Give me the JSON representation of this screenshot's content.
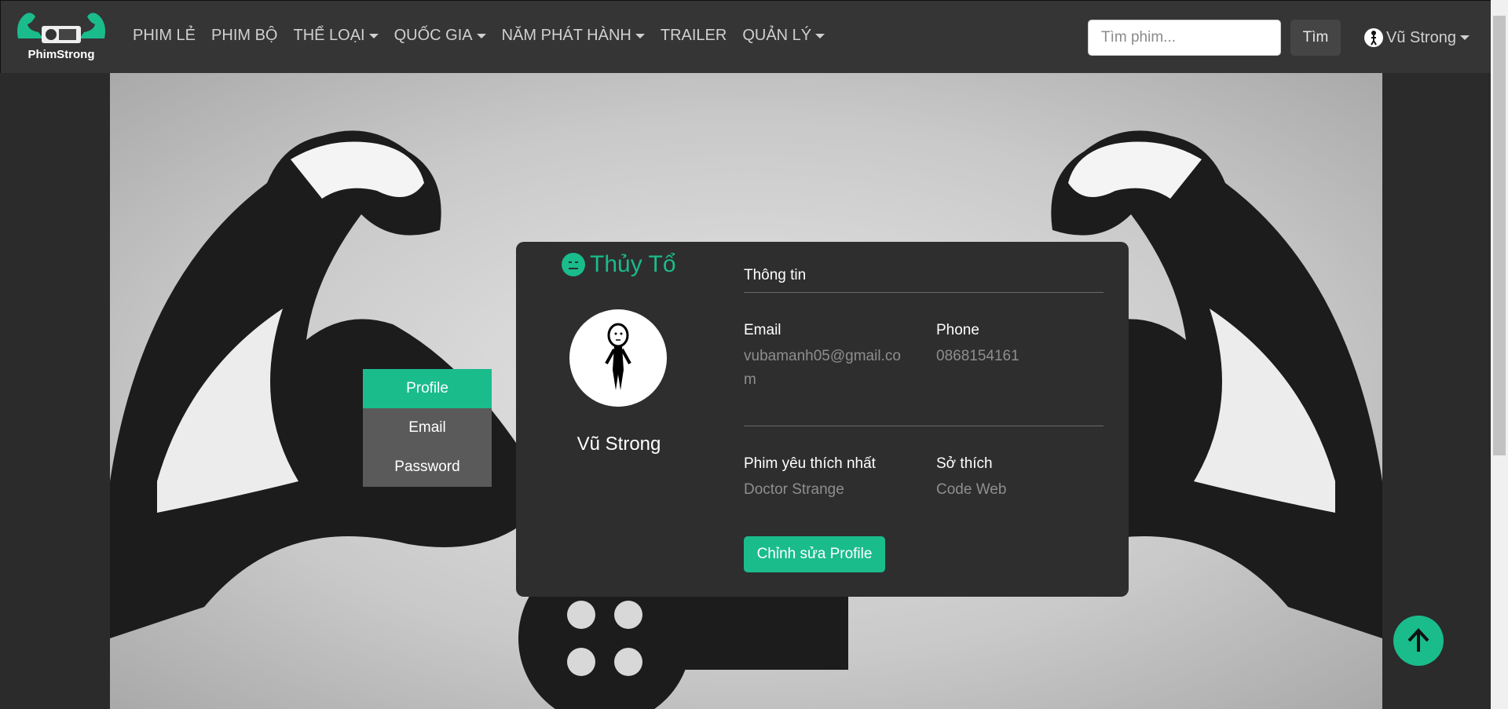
{
  "brand": {
    "name": "PhimStrong",
    "accent": "#1abc8c"
  },
  "nav": {
    "items": [
      {
        "label": "PHIM LẺ",
        "dropdown": false
      },
      {
        "label": "PHIM BỘ",
        "dropdown": false
      },
      {
        "label": "THỂ LOẠI",
        "dropdown": true
      },
      {
        "label": "QUỐC GIA",
        "dropdown": true
      },
      {
        "label": "NĂM PHÁT HÀNH",
        "dropdown": true
      },
      {
        "label": "TRAILER",
        "dropdown": false
      },
      {
        "label": "QUẢN LÝ",
        "dropdown": true
      }
    ],
    "search_placeholder": "Tìm phim...",
    "search_button": "Tìm",
    "user_name": "Vũ Strong"
  },
  "tabs": [
    {
      "label": "Profile",
      "active": true
    },
    {
      "label": "Email",
      "active": false
    },
    {
      "label": "Password",
      "active": false
    }
  ],
  "profile": {
    "rank": "Thủy Tổ",
    "name": "Vũ Strong",
    "section_title": "Thông tin",
    "email_label": "Email",
    "email_value": "vubamanh05@gmail.com",
    "phone_label": "Phone",
    "phone_value": "0868154161",
    "fav_movie_label": "Phim yêu thích nhất",
    "fav_movie_value": "Doctor Strange",
    "hobby_label": "Sở thích",
    "hobby_value": "Code Web",
    "edit_button": "Chỉnh sửa Profile"
  }
}
